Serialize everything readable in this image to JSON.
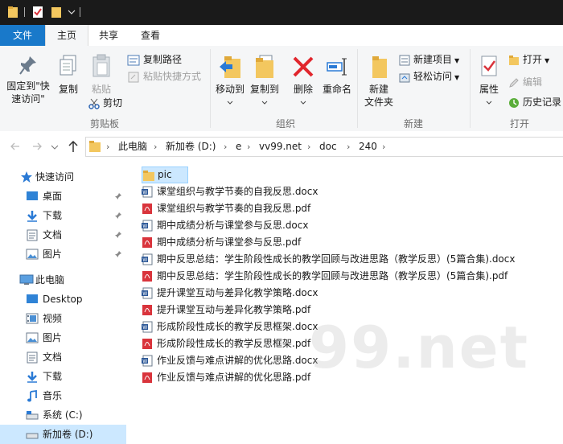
{
  "titlebar": {},
  "tabs": {
    "file": "文件",
    "home": "主页",
    "share": "共享",
    "view": "查看"
  },
  "ribbon": {
    "clipboard": {
      "pin_label_1": "固定到\"快",
      "pin_label_2": "速访问\"",
      "copy": "复制",
      "paste": "粘贴",
      "copy_path": "复制路径",
      "paste_shortcut": "粘贴快捷方式",
      "cut": "剪切",
      "group": "剪贴板"
    },
    "organize": {
      "move_to": "移动到",
      "copy_to": "复制到",
      "delete": "删除",
      "rename": "重命名",
      "group": "组织"
    },
    "new": {
      "new_folder_1": "新建",
      "new_folder_2": "文件夹",
      "new_item": "新建项目",
      "easy_access": "轻松访问",
      "group": "新建"
    },
    "open": {
      "properties": "属性",
      "open": "打开",
      "edit": "编辑",
      "history": "历史记录",
      "group": "打开"
    }
  },
  "address": {
    "crumbs": [
      "此电脑",
      "新加卷 (D:)",
      "e",
      "vv99.net",
      "doc",
      "240"
    ]
  },
  "nav": {
    "quick_access": "快速访问",
    "qa_items": [
      "桌面",
      "下载",
      "文档",
      "图片"
    ],
    "this_pc": "此电脑",
    "pc_items": [
      "Desktop",
      "视频",
      "图片",
      "文档",
      "下载",
      "音乐",
      "系统 (C:)",
      "新加卷 (D:)"
    ]
  },
  "files": [
    {
      "name": "pic",
      "type": "folder"
    },
    {
      "name": "课堂组织与教学节奏的自我反思.docx",
      "type": "docx"
    },
    {
      "name": "课堂组织与教学节奏的自我反思.pdf",
      "type": "pdf"
    },
    {
      "name": "期中成绩分析与课堂参与反思.docx",
      "type": "docx"
    },
    {
      "name": "期中成绩分析与课堂参与反思.pdf",
      "type": "pdf"
    },
    {
      "name": "期中反思总结：学生阶段性成长的教学回顾与改进思路（教学反思）(5篇合集).docx",
      "type": "docx"
    },
    {
      "name": "期中反思总结：学生阶段性成长的教学回顾与改进思路（教学反思）(5篇合集).pdf",
      "type": "pdf"
    },
    {
      "name": "提升课堂互动与差异化教学策略.docx",
      "type": "docx"
    },
    {
      "name": "提升课堂互动与差异化教学策略.pdf",
      "type": "pdf"
    },
    {
      "name": "形成阶段性成长的教学反思框架.docx",
      "type": "docx"
    },
    {
      "name": "形成阶段性成长的教学反思框架.pdf",
      "type": "pdf"
    },
    {
      "name": "作业反馈与难点讲解的优化思路.docx",
      "type": "docx"
    },
    {
      "name": "作业反馈与难点讲解的优化思路.pdf",
      "type": "pdf"
    }
  ],
  "watermark": "99.net",
  "colors": {
    "accent": "#1979ca",
    "folder": "#f3c75f",
    "pdf": "#d9343c",
    "word": "#2b5797",
    "delete": "#e1262d"
  }
}
